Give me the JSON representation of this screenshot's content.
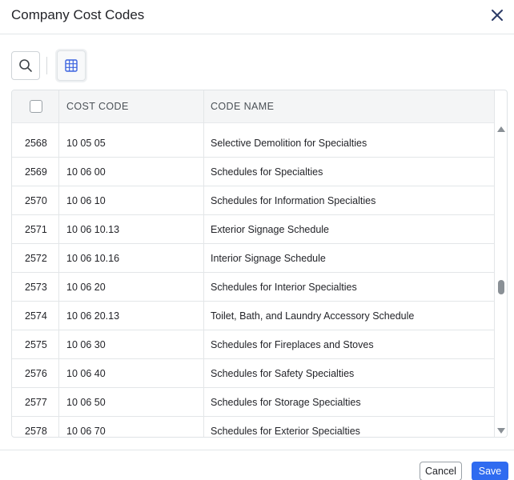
{
  "dialog": {
    "title": "Company Cost Codes"
  },
  "table": {
    "columns": {
      "cost_code": "COST CODE",
      "code_name": "CODE NAME"
    },
    "rows": [
      {
        "id": "2568",
        "code": "10 05 05",
        "name": "Selective Demolition for Specialties"
      },
      {
        "id": "2569",
        "code": "10 06 00",
        "name": "Schedules for Specialties"
      },
      {
        "id": "2570",
        "code": "10 06 10",
        "name": "Schedules for Information Specialties"
      },
      {
        "id": "2571",
        "code": "10 06 10.13",
        "name": "Exterior Signage Schedule"
      },
      {
        "id": "2572",
        "code": "10 06 10.16",
        "name": "Interior Signage Schedule"
      },
      {
        "id": "2573",
        "code": "10 06 20",
        "name": "Schedules for Interior Specialties"
      },
      {
        "id": "2574",
        "code": "10 06 20.13",
        "name": "Toilet, Bath, and Laundry Accessory Schedule"
      },
      {
        "id": "2575",
        "code": "10 06 30",
        "name": "Schedules for Fireplaces and Stoves"
      },
      {
        "id": "2576",
        "code": "10 06 40",
        "name": "Schedules for Safety Specialties"
      },
      {
        "id": "2577",
        "code": "10 06 50",
        "name": "Schedules for Storage Specialties"
      },
      {
        "id": "2578",
        "code": "10 06 70",
        "name": "Schedules for Exterior Specialties"
      }
    ]
  },
  "footer": {
    "cancel_label": "Cancel",
    "save_label": "Save"
  },
  "icons": {
    "close": "close-icon",
    "search": "search-icon",
    "grid": "grid-icon",
    "checkbox": "checkbox"
  },
  "colors": {
    "accent": "#2f6bf0",
    "grid_icon": "#3b63e0",
    "close_icon": "#2b3a67"
  }
}
